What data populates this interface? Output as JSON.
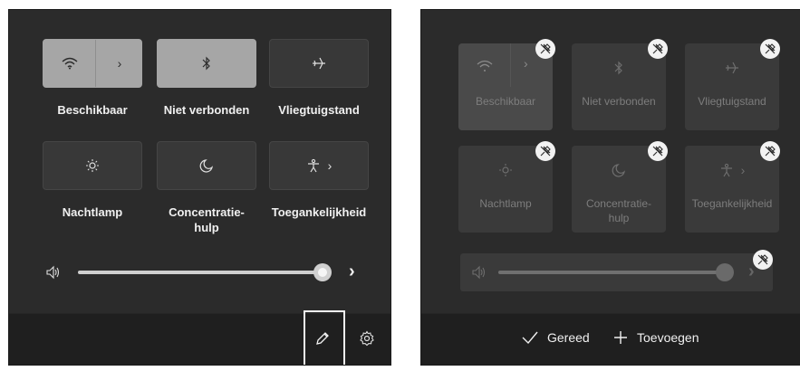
{
  "left_panel": {
    "tiles": [
      {
        "label": "Beschikbaar",
        "icon": "wifi-icon",
        "state": "on",
        "has_chevron": true
      },
      {
        "label": "Niet verbonden",
        "icon": "bluetooth-icon",
        "state": "on"
      },
      {
        "label": "Vliegtuigstand",
        "icon": "airplane-icon",
        "state": "off"
      },
      {
        "label": "Nachtlamp",
        "icon": "night-light-icon",
        "state": "off"
      },
      {
        "label": "Concentratie-hulp",
        "label_line1": "Concentratie-",
        "label_line2": "hulp",
        "icon": "moon-icon",
        "state": "off"
      },
      {
        "label": "Toegankelijkheid",
        "icon": "accessibility-icon",
        "state": "off",
        "has_chevron": true
      }
    ],
    "volume": {
      "icon": "speaker-icon",
      "level": 1.0,
      "chevron": "›"
    },
    "footer": {
      "edit_icon": "pencil-icon",
      "settings_icon": "gear-icon"
    }
  },
  "right_panel": {
    "tiles": [
      {
        "label": "Beschikbaar",
        "icon": "wifi-icon"
      },
      {
        "label": "Niet verbonden",
        "icon": "bluetooth-icon"
      },
      {
        "label": "Vliegtuigstand",
        "icon": "airplane-icon"
      },
      {
        "label": "Nachtlamp",
        "icon": "night-light-icon"
      },
      {
        "label": "Concentratie-hulp",
        "label_line1": "Concentratie-",
        "label_line2": "hulp",
        "icon": "moon-icon"
      },
      {
        "label": "Toegankelijkheid",
        "icon": "accessibility-icon"
      }
    ],
    "volume": {
      "icon": "speaker-icon",
      "level": 1.0
    },
    "unpin_icon": "unpin-icon",
    "footer": {
      "done_label": "Gereed",
      "add_label": "Toevoegen"
    }
  },
  "colors": {
    "panel": "#2b2b2b",
    "footer": "#1f1f1f",
    "tile_on": "#a6a6a6",
    "tile_off": "#383838"
  }
}
